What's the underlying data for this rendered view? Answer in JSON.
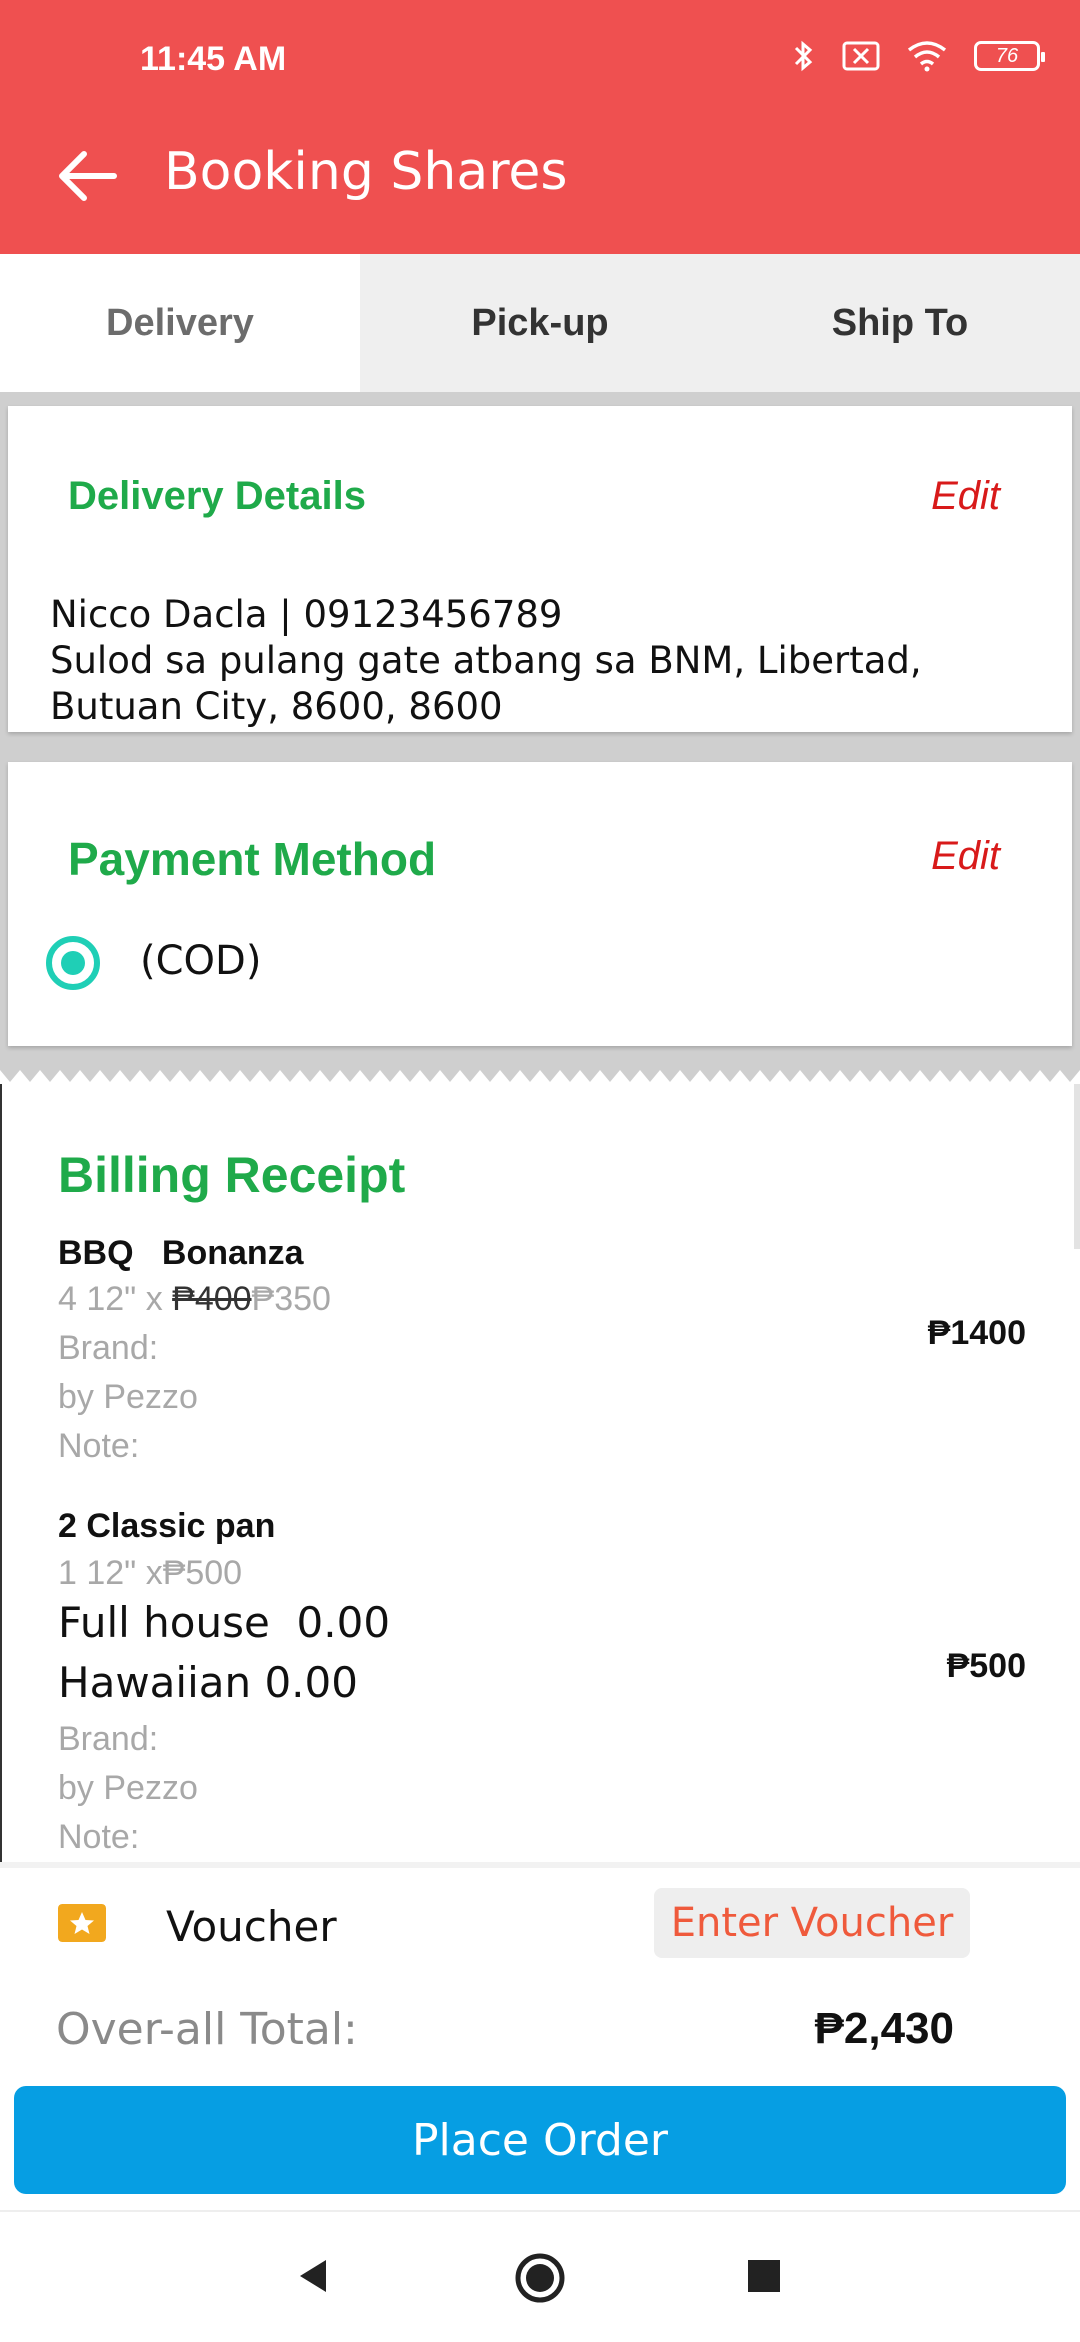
{
  "status": {
    "time": "11:45 AM",
    "battery": "76"
  },
  "header": {
    "title": "Booking Shares"
  },
  "tabs": [
    {
      "label": "Delivery"
    },
    {
      "label": "Pick-up"
    },
    {
      "label": "Ship To"
    }
  ],
  "delivery": {
    "heading": "Delivery Details",
    "edit": "Edit",
    "contact": "Nicco Dacla | 09123456789",
    "address": "Sulod sa pulang gate atbang sa BNM, Libertad, Butuan City, 8600, 8600"
  },
  "payment": {
    "heading": "Payment Method",
    "edit": "Edit",
    "method": "(COD)"
  },
  "receipt": {
    "title": "Billing Receipt",
    "items": [
      {
        "name": "BBQ   Bonanza",
        "qty_prefix": "4 12\" x ",
        "old_price": "₱400",
        "new_price": "₱350",
        "brand_label": "Brand:",
        "brand": "by Pezzo",
        "note": "Note:",
        "total": "₱1400"
      },
      {
        "name": "2 Classic pan",
        "qty": "1 12\" x₱500",
        "option1": "Full house  0.00",
        "option2": "Hawaiian 0.00",
        "brand_label": "Brand:",
        "brand": "by Pezzo",
        "note": "Note:",
        "total": "₱500"
      }
    ]
  },
  "voucher": {
    "label": "Voucher",
    "button": "Enter Voucher"
  },
  "total": {
    "label": "Over-all Total:",
    "value": "₱2,430"
  },
  "place_order": "Place Order",
  "colors": {
    "appbar": "#ef5050",
    "green": "#1faa4a",
    "edit": "#d81a1a",
    "button": "#069ee3"
  }
}
